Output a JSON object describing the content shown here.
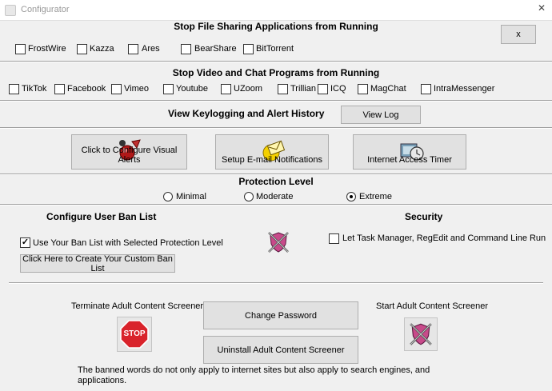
{
  "window": {
    "title": "Configurator",
    "close_glyph": "✕"
  },
  "file_sharing": {
    "heading": "Stop File Sharing Applications from Running",
    "items": [
      "FrostWire",
      "Kazza",
      "Ares",
      "BearShare",
      "BitTorrent"
    ],
    "close_button": "x"
  },
  "video_chat": {
    "heading": "Stop Video and Chat Programs from Running",
    "items": [
      "TikTok",
      "Facebook",
      "Vimeo",
      "Youtube",
      "UZoom",
      "Trillian",
      "ICQ",
      "MagChat",
      "IntraMessenger"
    ]
  },
  "keylog": {
    "heading": "View Keylogging and Alert History",
    "view_log": "View Log"
  },
  "tools": {
    "visual_alerts": "Click to Configure Visual Alerts",
    "email": "Setup E-mail Notifications",
    "timer": "Internet Access Timer"
  },
  "protection": {
    "heading": "Protection Level",
    "levels": [
      "Minimal",
      "Moderate",
      "Extreme"
    ],
    "selected": "Extreme"
  },
  "ban_list": {
    "heading": "Configure User Ban List",
    "use_label": "Use Your Ban List with Selected Protection Level",
    "use_checked": true,
    "create_button": "Click Here to Create Your Custom Ban List"
  },
  "security": {
    "heading": "Security",
    "label": "Let  Task Manager, RegEdit and Command Line Run",
    "checked": false
  },
  "bottom": {
    "terminate_label": "Terminate Adult Content Screener",
    "stop_sign": "STOP",
    "change_password": "Change Password",
    "uninstall": "Uninstall Adult Content Screener",
    "start_label": "Start Adult Content Screener",
    "note": "The banned words do not only apply to internet sites but also apply to search engines, and applications."
  },
  "colors": {
    "background": "#f0f0f0",
    "button": "#e1e1e1",
    "stop_red": "#d9232b"
  }
}
